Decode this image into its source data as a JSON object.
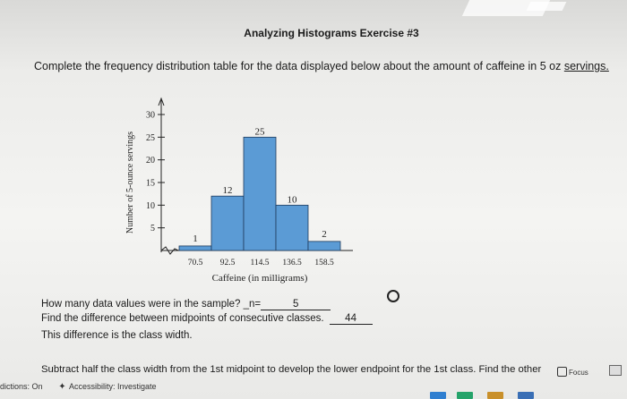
{
  "page": {
    "title": "Analyzing Histograms Exercise #3",
    "instruction_main": "Complete the frequency distribution table for the data displayed below about the amount of caffeine in 5 oz ",
    "instruction_underlined": "servings.",
    "questions": {
      "q1_text": "How many data values were in the sample? _n=",
      "q1_answer": "5",
      "q2_text": "Find the difference between midpoints of consecutive classes.",
      "q2_answer": "44",
      "q3_text": "This difference is the class width.",
      "q4_text": "Subtract half the class width from the 1st midpoint to develop the lower endpoint for the 1st class. Find the other"
    }
  },
  "bottom_bar": {
    "dictionary": "dictions: On",
    "accessibility": "Accessibility: Investigate",
    "focus": "Focus"
  },
  "chart_data": {
    "type": "bar",
    "categories": [
      "70.5",
      "92.5",
      "114.5",
      "136.5",
      "158.5"
    ],
    "values": [
      1,
      12,
      25,
      10,
      2
    ],
    "xlabel": "Caffeine (in milligrams)",
    "ylabel": "Number of 5-ounce servings",
    "ylim": [
      0,
      30
    ],
    "yticks": [
      5,
      10,
      15,
      20,
      25,
      30
    ],
    "data_labels": [
      "1",
      "12",
      "25",
      "10",
      "2"
    ],
    "bar_color": "#5b9bd5",
    "grid": false
  }
}
